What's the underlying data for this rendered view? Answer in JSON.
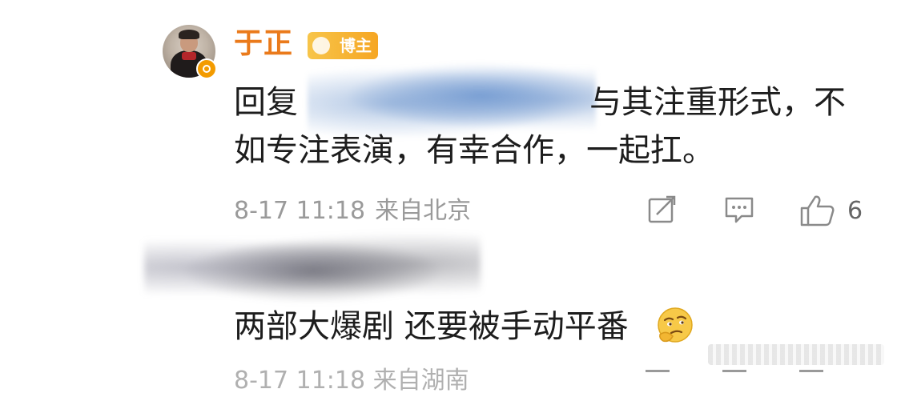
{
  "comment1": {
    "username": "于正",
    "badge_label": "博主",
    "reply_prefix": "回复",
    "reply_tail": "与其注重形式，不",
    "reply_line2": "如专注表演，有幸合作，一起扛。",
    "timestamp": "8-17 11:18",
    "location": "来自北京",
    "like_count": "6"
  },
  "comment2": {
    "text": "两部大爆剧 还要被手动平番",
    "timestamp_cut": "8-17 11:18 来自湖南"
  },
  "icons": {
    "forward": "share-edit-icon",
    "comment": "comment-bubble-icon",
    "like": "thumbs-up-icon",
    "verified": "verified-badge-icon",
    "emoji": "thinking-face-emoji"
  },
  "colors": {
    "username": "#ea7a1b",
    "badge": "#f6a623",
    "meta": "#9a9a9a",
    "text": "#1d1d1d"
  }
}
